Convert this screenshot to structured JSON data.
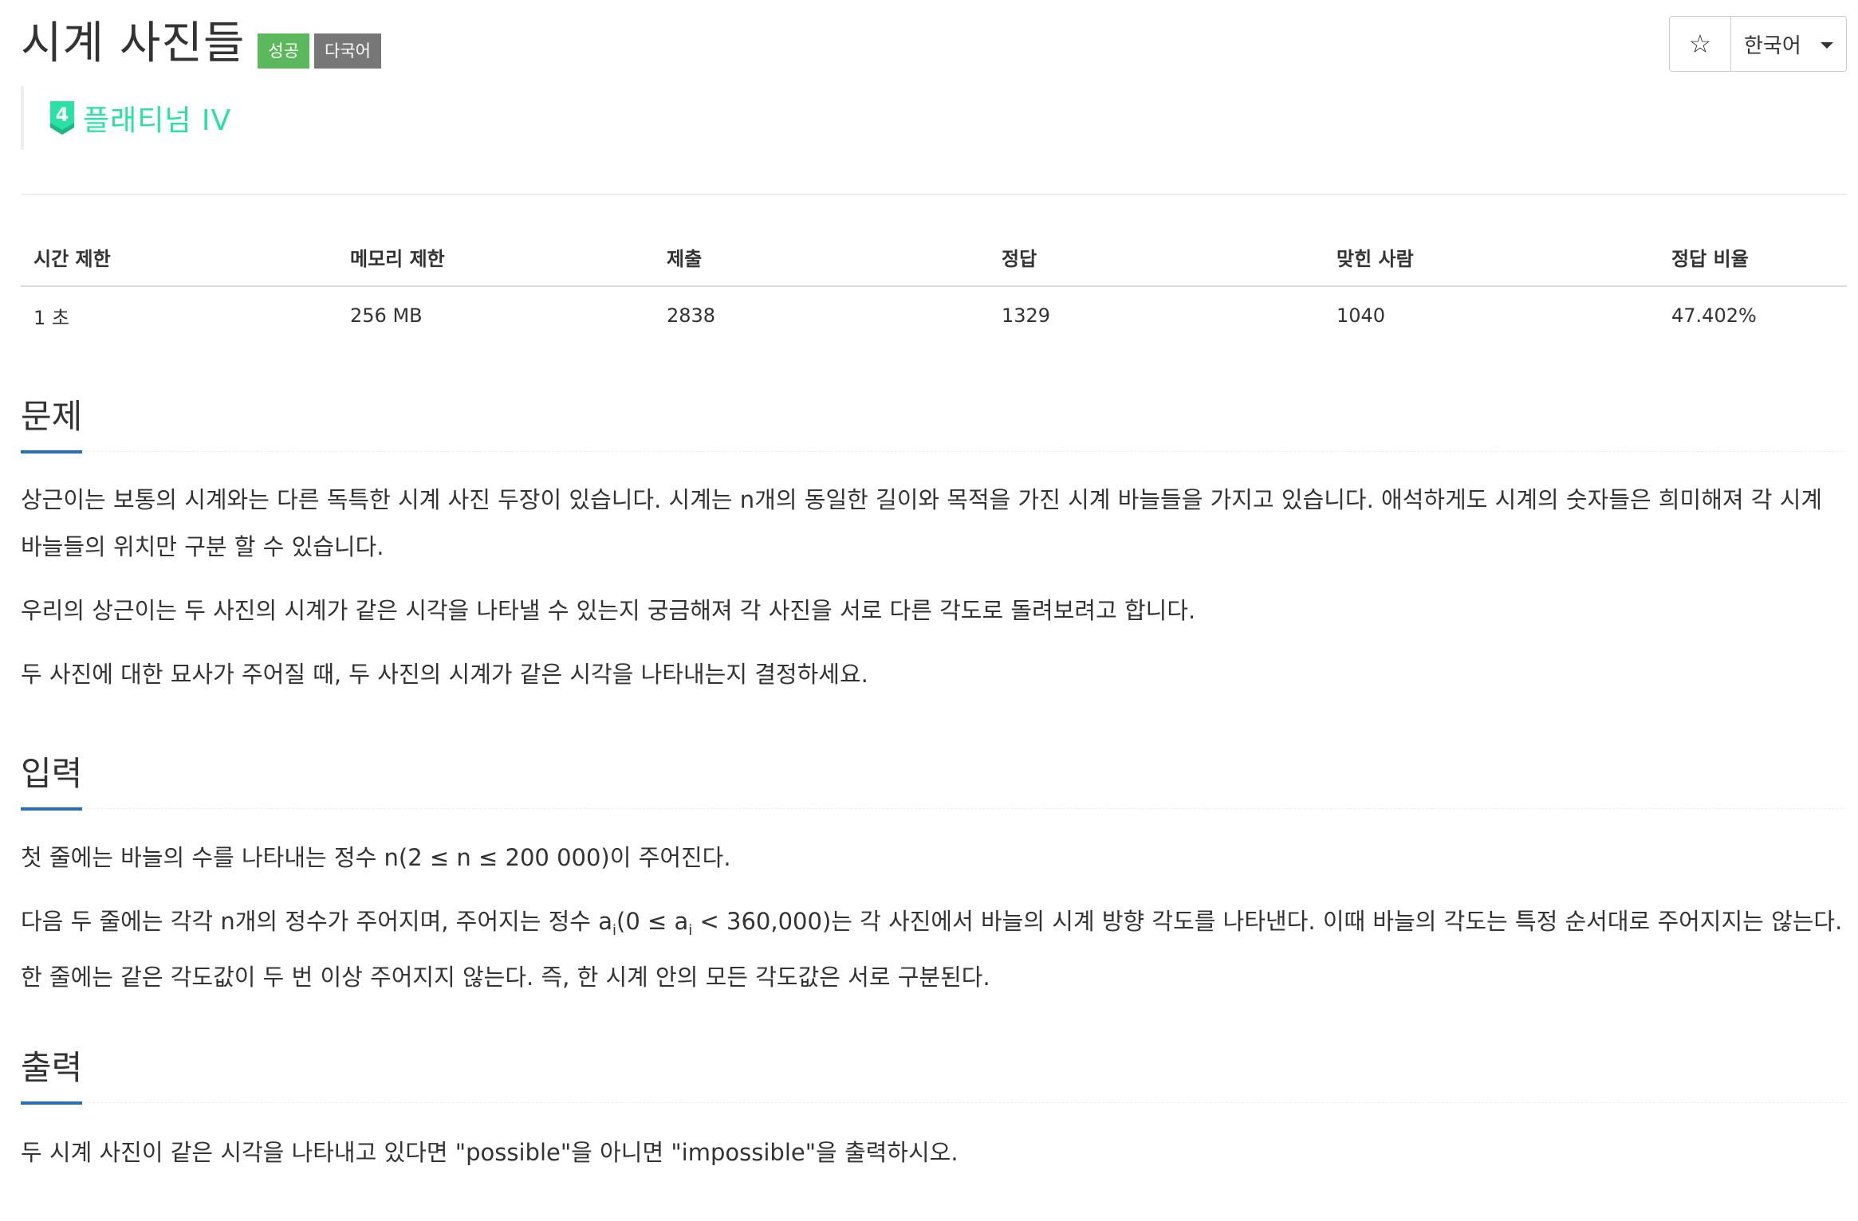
{
  "header": {
    "title": "시계 사진들",
    "badges": {
      "success": "성공",
      "multilang": "다국어"
    },
    "tier": {
      "number": "4",
      "label": "플래티넘 IV"
    }
  },
  "controls": {
    "star_icon": "☆",
    "language": "한국어"
  },
  "stats": {
    "headers": [
      "시간 제한",
      "메모리 제한",
      "제출",
      "정답",
      "맞힌 사람",
      "정답 비율"
    ],
    "values": [
      "1 초",
      "256 MB",
      "2838",
      "1329",
      "1040",
      "47.402%"
    ]
  },
  "sections": {
    "problem": {
      "title": "문제",
      "p1": "상근이는 보통의 시계와는 다른 독특한 시계 사진 두장이 있습니다. 시계는 n개의 동일한 길이와 목적을 가진 시계 바늘들을 가지고 있습니다. 애석하게도 시계의 숫자들은 희미해져 각 시계 바늘들의 위치만 구분 할 수 있습니다.",
      "p2": "우리의 상근이는 두 사진의 시계가 같은 시각을 나타낼 수 있는지 궁금해져 각 사진을 서로 다른 각도로 돌려보려고 합니다.",
      "p3": "두 사진에 대한 묘사가 주어질 때, 두 사진의 시계가 같은 시각을 나타내는지 결정하세요."
    },
    "input": {
      "title": "입력",
      "p1": "첫 줄에는 바늘의 수를 나타내는 정수 n(2 ≤ n ≤ 200 000)이 주어진다.",
      "p2_a": "다음 두 줄에는 각각 n개의 정수가 주어지며, 주어지는 정수 a",
      "p2_sub1": "i",
      "p2_b": "(0 ≤ a",
      "p2_sub2": "i",
      "p2_c": " < 360,000)는 각 사진에서 바늘의 시계 방향 각도를 나타낸다. 이때 바늘의 각도는 특정 순서대로 주어지지는 않는다. 한 줄에는 같은 각도값이 두 번 이상 주어지지 않는다. 즉, 한 시계 안의 모든 각도값은 서로 구분된다."
    },
    "output": {
      "title": "출력",
      "p1": "두 시계 사진이 같은 시각을 나타내고 있다면 \"possible\"을 아니면 \"impossible\"을 출력하시오."
    }
  },
  "colors": {
    "success_badge": "#5cb85c",
    "multilang_badge": "#777777",
    "tier": "#27e2a4",
    "section_underline": "#2a6ebb"
  }
}
